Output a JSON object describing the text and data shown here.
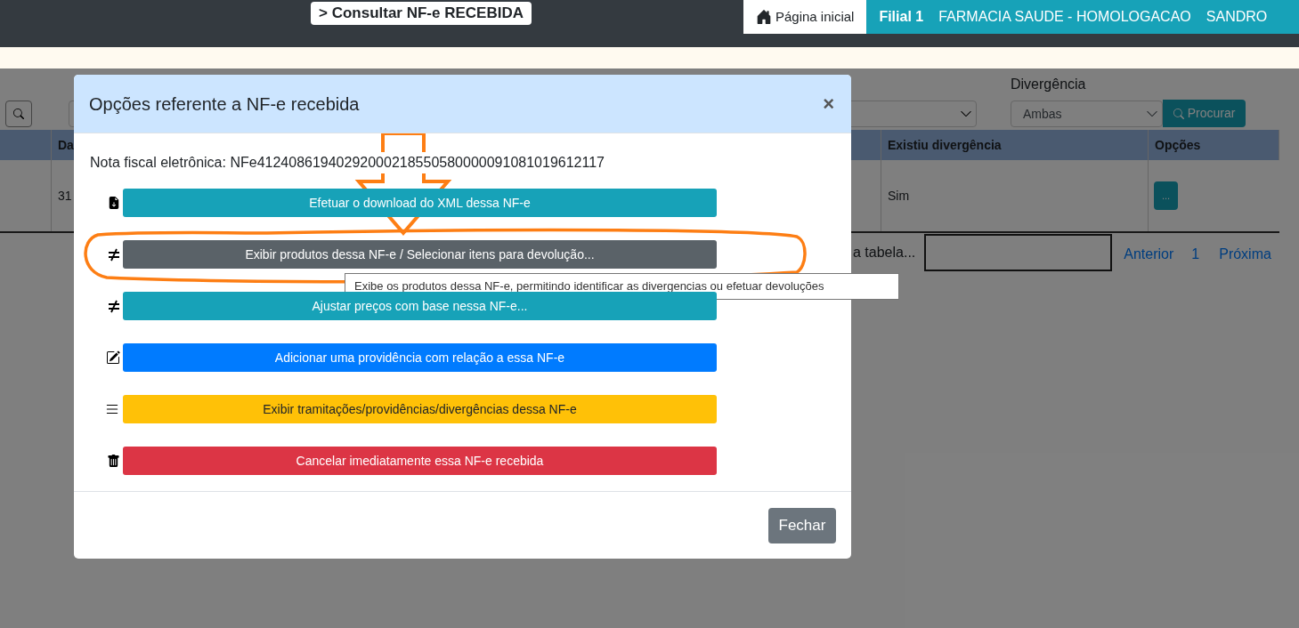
{
  "top_bar": {
    "page_title": "> Consultar NF-e RECEBIDA",
    "home_link": "Página inicial",
    "branch": "Filial 1",
    "company": "FARMACIA SAUDE - HOMOLOGACAO",
    "user": "SANDRO"
  },
  "filters": {
    "divergence_label": "Divergência",
    "divergence_value": "Ambas",
    "search_button": "Procurar"
  },
  "table": {
    "columns": [
      "Da",
      "Existiu divergência",
      "Opções"
    ],
    "rows": [
      {
        "cells": [
          "31",
          "Sim"
        ],
        "options_button": "..."
      }
    ]
  },
  "table_search_label": "a tabela...",
  "pagination": {
    "previous": "Anterior",
    "page": "1",
    "next": "Próxima"
  },
  "modal": {
    "title": "Opções referente a NF-e recebida",
    "close": "×",
    "invoice": "Nota fiscal eletrônica: NFe41240861940292000218550580000091081019612117",
    "actions": [
      {
        "label": "Efetuar o download do XML dessa NF-e",
        "kind": "download",
        "color": "#17a2b8"
      },
      {
        "label": "Exibir produtos dessa NF-e / Selecionar itens para devolução...",
        "kind": "compare",
        "color": "#5a6268"
      },
      {
        "label": "Ajustar preços com base nessa NF-e...",
        "kind": "compare",
        "color": "#17a2b8"
      },
      {
        "label": "Adicionar uma providência com relação a essa NF-e",
        "kind": "edit",
        "color": "#007bff"
      },
      {
        "label": "Exibir tramitações/providências/divergências dessa NF-e",
        "kind": "list",
        "color": "#ffc107"
      },
      {
        "label": "Cancelar imediatamente essa NF-e recebida",
        "kind": "delete",
        "color": "#dc3545"
      }
    ],
    "tooltip": "Exibe os produtos dessa NF-e, permitindo identificar as divergencias ou efetuar devoluções",
    "footer_button": "Fechar"
  }
}
